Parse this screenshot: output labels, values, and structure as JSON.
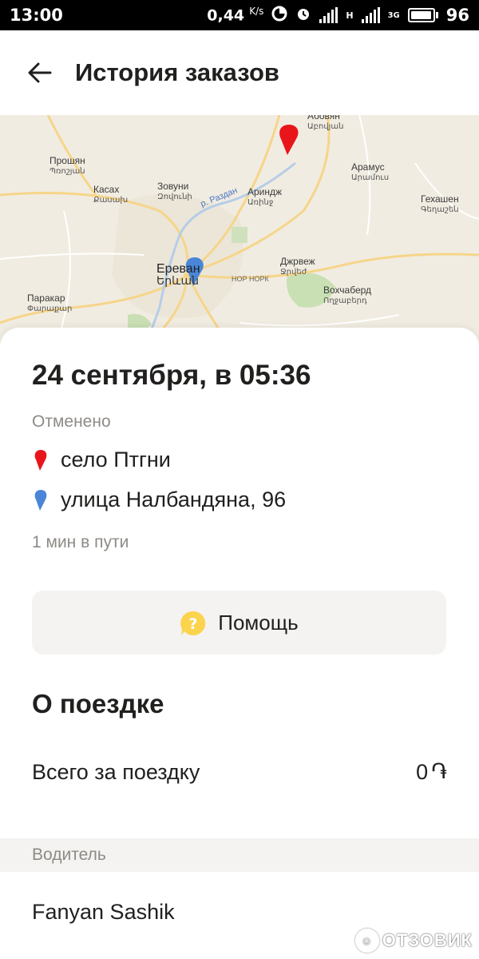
{
  "status_bar": {
    "time": "13:00",
    "net_speed": "0,44",
    "net_speed_unit": "K/s",
    "net_type_1": "H",
    "net_type_2": "3G",
    "battery_level": "96"
  },
  "header": {
    "title": "История заказов"
  },
  "map": {
    "labels": [
      {
        "name": "Абовян",
        "sub": "Աբովյան"
      },
      {
        "name": "Прошян",
        "sub": "Պռոշյան"
      },
      {
        "name": "Паракар",
        "sub": "Փարաքար"
      },
      {
        "name": "Касах",
        "sub": "Քասախ"
      },
      {
        "name": "Зовуни",
        "sub": "Զովունի"
      },
      {
        "name": "Ариндж",
        "sub": "Առինջ"
      },
      {
        "name": "Арамус",
        "sub": "Արամուս"
      },
      {
        "name": "Гехашен",
        "sub": "Գեղաշեն"
      },
      {
        "name": "Джрвеж",
        "sub": "Ջրվեժ"
      },
      {
        "name": "Вохчаберд",
        "sub": "Ողջաբերդ"
      },
      {
        "name": "Ереван",
        "sub": "Երևան"
      },
      {
        "name": "НОР НОРК"
      },
      {
        "name": "р. Раздан"
      }
    ],
    "pin_colors": {
      "from": "#e8161b",
      "to": "#4a86d8"
    }
  },
  "order": {
    "date": "24 сентября, в 05:36",
    "status": "Отменено",
    "from": "село Птгни",
    "to": "улица Налбандяна, 96",
    "trip_time": "1 мин в пути"
  },
  "help": {
    "label": "Помощь",
    "icon": "question-icon"
  },
  "trip": {
    "section_title": "О поездке",
    "total_label": "Всего за поездку",
    "total_value": "0",
    "currency_symbol": "֏"
  },
  "driver": {
    "section_label": "Водитель",
    "name": "Fanyan Sashik"
  },
  "watermark": {
    "text": "ОТЗОВИК"
  },
  "colors": {
    "text": "#21201f",
    "muted": "#8e8b86",
    "help_icon": "#fcd34d",
    "band": "#f4f3f1"
  }
}
